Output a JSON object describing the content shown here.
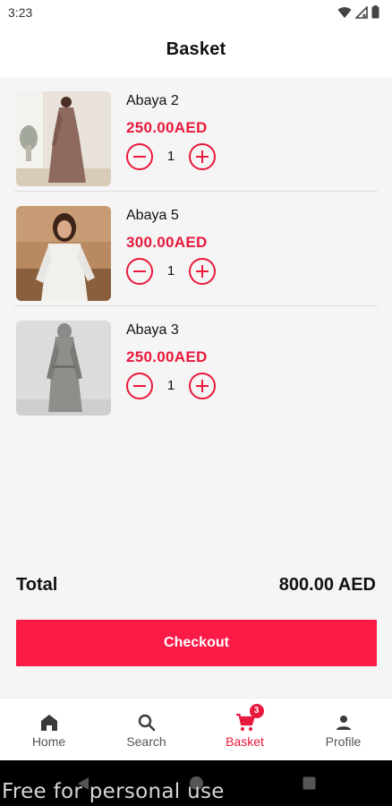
{
  "status_bar": {
    "time": "3:23"
  },
  "header": {
    "title": "Basket"
  },
  "cart": {
    "items": [
      {
        "name": "Abaya 2",
        "price": "250.00AED",
        "quantity": "1"
      },
      {
        "name": "Abaya 5",
        "price": "300.00AED",
        "quantity": "1"
      },
      {
        "name": "Abaya 3",
        "price": "250.00AED",
        "quantity": "1"
      }
    ]
  },
  "summary": {
    "total_label": "Total",
    "total_value": "800.00 AED"
  },
  "checkout": {
    "label": "Checkout"
  },
  "bottom_nav": {
    "items": [
      {
        "label": "Home",
        "icon": "home-icon"
      },
      {
        "label": "Search",
        "icon": "search-icon"
      },
      {
        "label": "Basket",
        "icon": "cart-icon",
        "badge": "3",
        "active": true
      },
      {
        "label": "Profile",
        "icon": "person-icon"
      }
    ]
  },
  "watermark": {
    "text": "Free for personal use"
  },
  "colors": {
    "accent": "#e8193c",
    "checkout": "#fc1a47",
    "background": "#f5f5f5"
  }
}
